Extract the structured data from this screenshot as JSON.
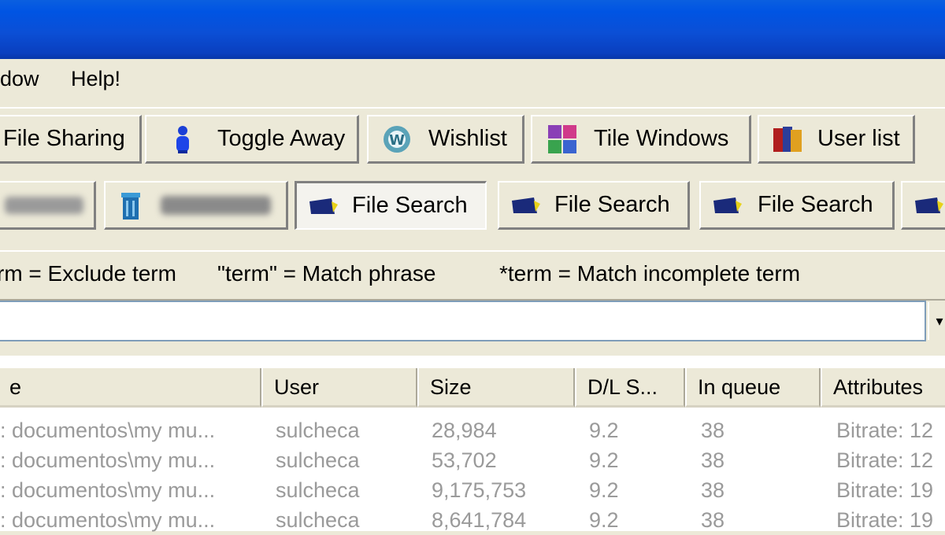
{
  "menu": {
    "items": [
      "dow",
      "Help!"
    ]
  },
  "toolbar": {
    "buttons": [
      {
        "label": "File Sharing",
        "icon": "file-sharing-icon"
      },
      {
        "label": "Toggle Away",
        "icon": "person-icon"
      },
      {
        "label": "Wishlist",
        "icon": "wishlist-icon"
      },
      {
        "label": "Tile Windows",
        "icon": "tile-windows-icon"
      },
      {
        "label": "User list",
        "icon": "user-list-icon"
      }
    ]
  },
  "tabs": {
    "items": [
      {
        "label": "File Search",
        "active": true
      },
      {
        "label": "File Search",
        "active": false
      },
      {
        "label": "File Search",
        "active": false
      }
    ]
  },
  "hints": [
    "rm = Exclude term",
    "\"term\" = Match phrase",
    "*term = Match incomplete term"
  ],
  "search": {
    "value": ""
  },
  "results": {
    "columns": [
      "e",
      "User",
      "Size",
      "D/L S...",
      "In queue",
      "Attributes"
    ],
    "rows": [
      {
        "path": ": documentos\\my mu...",
        "user": "sulcheca",
        "size": "28,984",
        "dl": "9.2",
        "queue": "38",
        "attributes": "Bitrate: 12"
      },
      {
        "path": ": documentos\\my mu...",
        "user": "sulcheca",
        "size": "53,702",
        "dl": "9.2",
        "queue": "38",
        "attributes": "Bitrate: 12"
      },
      {
        "path": ": documentos\\my mu...",
        "user": "sulcheca",
        "size": "9,175,753",
        "dl": "9.2",
        "queue": "38",
        "attributes": "Bitrate: 19"
      },
      {
        "path": ": documentos\\my mu...",
        "user": "sulcheca",
        "size": "8,641,784",
        "dl": "9.2",
        "queue": "38",
        "attributes": "Bitrate: 19"
      }
    ]
  }
}
